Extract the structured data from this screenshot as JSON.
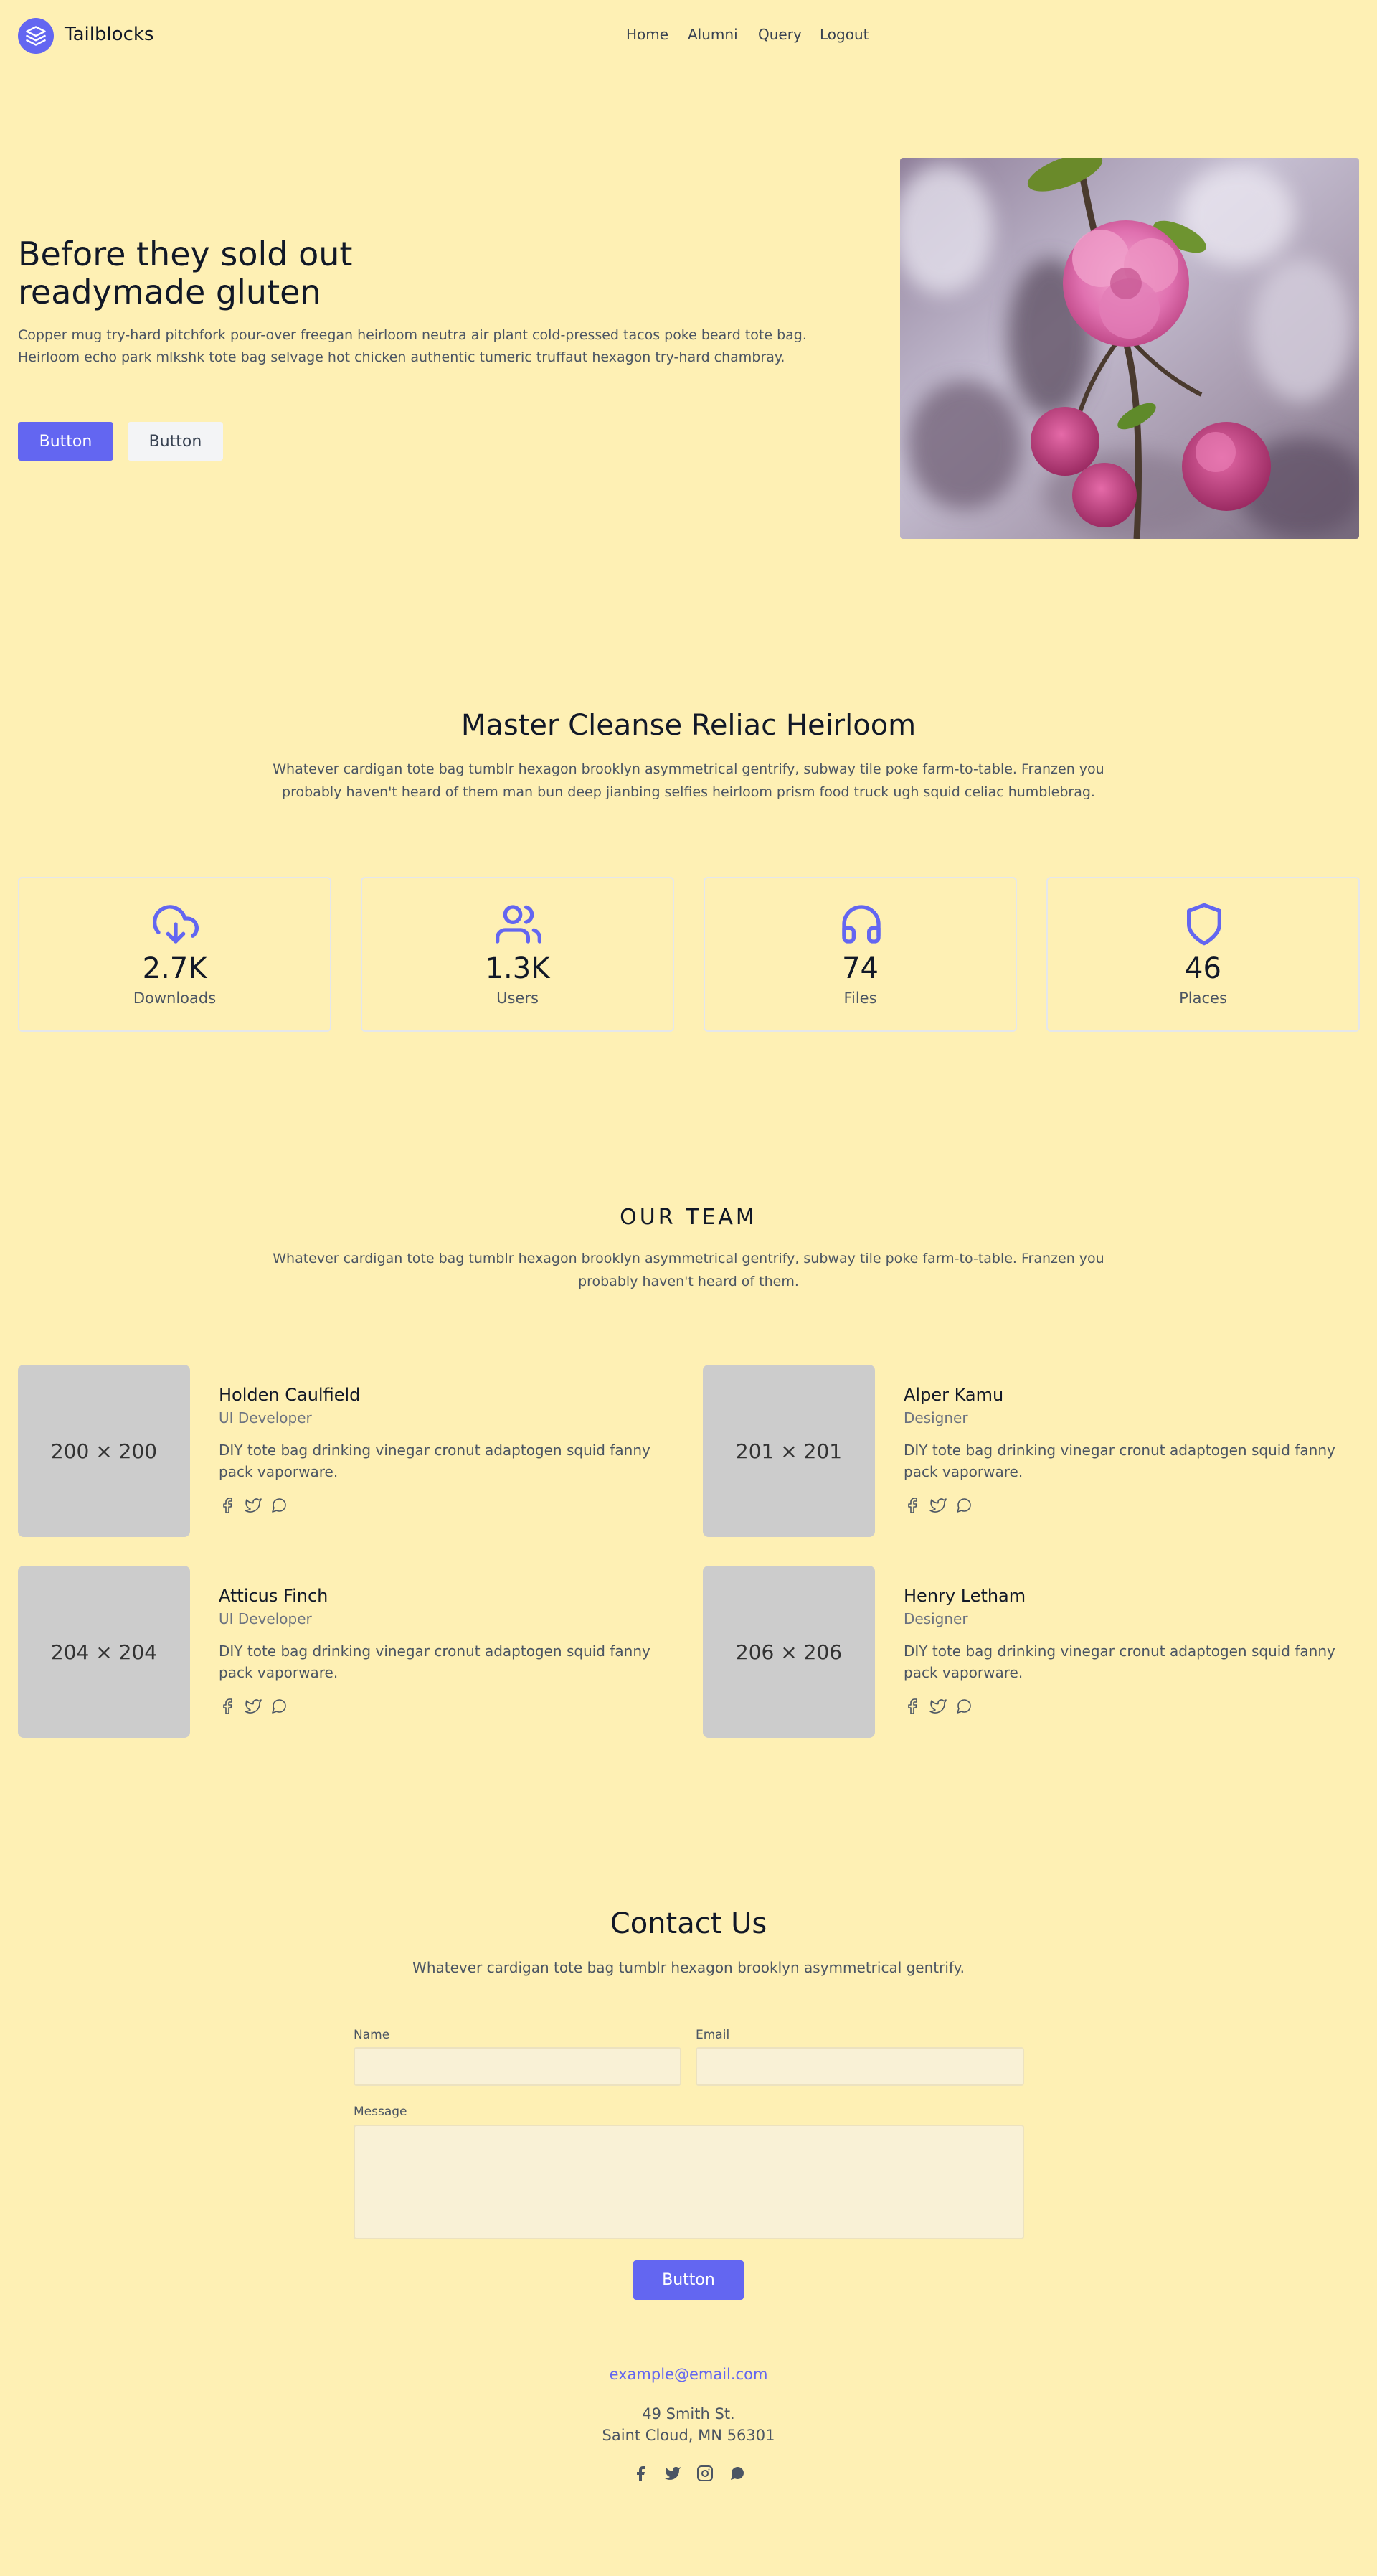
{
  "header": {
    "brand": "Tailblocks",
    "nav": [
      "Home",
      "Alumni",
      "Query",
      "Logout"
    ]
  },
  "hero": {
    "title_line1": "Before they sold out",
    "title_line2": "readymade gluten",
    "text": "Copper mug try-hard pitchfork pour-over freegan heirloom neutra air plant cold-pressed tacos poke beard tote bag. Heirloom echo park mlkshk tote bag selvage hot chicken authentic tumeric truffaut hexagon try-hard chambray.",
    "primary_button": "Button",
    "secondary_button": "Button",
    "image": "pink-flower-photo"
  },
  "stats": {
    "title": "Master Cleanse Reliac Heirloom",
    "text": "Whatever cardigan tote bag tumblr hexagon brooklyn asymmetrical gentrify, subway tile poke farm-to-table. Franzen you probably haven't heard of them man bun deep jianbing selfies heirloom prism food truck ugh squid celiac humblebrag.",
    "items": [
      {
        "icon": "download-cloud-icon",
        "value": "2.7K",
        "label": "Downloads"
      },
      {
        "icon": "users-icon",
        "value": "1.3K",
        "label": "Users"
      },
      {
        "icon": "headphones-icon",
        "value": "74",
        "label": "Files"
      },
      {
        "icon": "shield-icon",
        "value": "46",
        "label": "Places"
      }
    ]
  },
  "team": {
    "title": "OUR TEAM",
    "text": "Whatever cardigan tote bag tumblr hexagon brooklyn asymmetrical gentrify, subway tile poke farm-to-table. Franzen you probably haven't heard of them.",
    "members": [
      {
        "placeholder": "200 × 200",
        "name": "Holden Caulfield",
        "role": "UI Developer",
        "bio": "DIY tote bag drinking vinegar cronut adaptogen squid fanny pack vaporware."
      },
      {
        "placeholder": "201 × 201",
        "name": "Alper Kamu",
        "role": "Designer",
        "bio": "DIY tote bag drinking vinegar cronut adaptogen squid fanny pack vaporware."
      },
      {
        "placeholder": "204 × 204",
        "name": "Atticus Finch",
        "role": "UI Developer",
        "bio": "DIY tote bag drinking vinegar cronut adaptogen squid fanny pack vaporware."
      },
      {
        "placeholder": "206 × 206",
        "name": "Henry Letham",
        "role": "Designer",
        "bio": "DIY tote bag drinking vinegar cronut adaptogen squid fanny pack vaporware."
      }
    ]
  },
  "contact": {
    "title": "Contact Us",
    "text": "Whatever cardigan tote bag tumblr hexagon brooklyn asymmetrical gentrify.",
    "name_label": "Name",
    "name_value": "",
    "email_label": "Email",
    "email_value": "",
    "message_label": "Message",
    "message_value": "",
    "submit": "Button",
    "email": "example@email.com",
    "address_line1": "49 Smith St.",
    "address_line2": "Saint Cloud, MN 56301"
  },
  "colors": {
    "background": "#fef0b4",
    "accent": "#6366f1",
    "heading": "#111827",
    "body_text": "#4b5563"
  }
}
